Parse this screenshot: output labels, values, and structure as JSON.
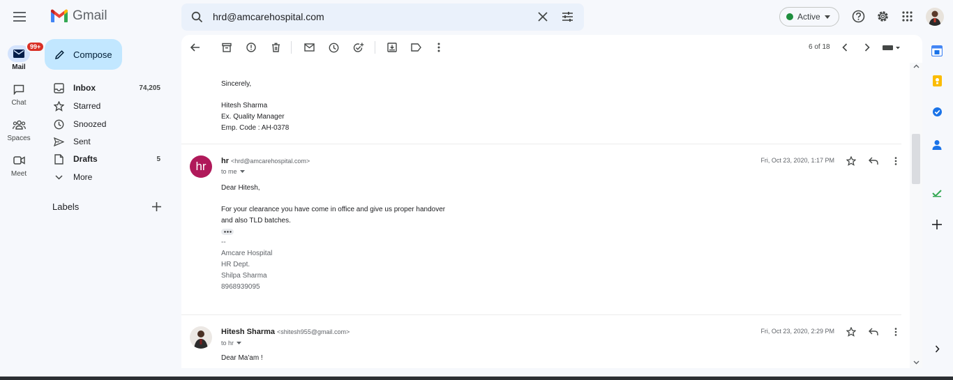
{
  "app": {
    "name": "Gmail"
  },
  "rail": {
    "mail_label": "Mail",
    "mail_badge": "99+",
    "chat_label": "Chat",
    "spaces_label": "Spaces",
    "meet_label": "Meet"
  },
  "compose_label": "Compose",
  "nav": [
    {
      "label": "Inbox",
      "count": "74,205",
      "bold": true,
      "icon": "inbox-icon"
    },
    {
      "label": "Starred",
      "count": "",
      "bold": false,
      "icon": "star-icon"
    },
    {
      "label": "Snoozed",
      "count": "",
      "bold": false,
      "icon": "clock-icon"
    },
    {
      "label": "Sent",
      "count": "",
      "bold": false,
      "icon": "send-icon"
    },
    {
      "label": "Drafts",
      "count": "5",
      "bold": true,
      "icon": "draft-icon"
    },
    {
      "label": "More",
      "count": "",
      "bold": false,
      "icon": "chevron-down-icon"
    }
  ],
  "labels_heading": "Labels",
  "search": {
    "value": "hrd@amcarehospital.com"
  },
  "status": {
    "label": "Active",
    "color": "#1e8e3e"
  },
  "toolbar": {
    "pagination": "6 of 18"
  },
  "thread": {
    "prev_signature": [
      "Sincerely,",
      "Hitesh Sharma",
      "Ex. Quality Manager",
      "Emp. Code : AH-0378"
    ],
    "message1": {
      "avatar_text": "hr",
      "avatar_color": "#b0195a",
      "sender_name": "hr",
      "sender_email": "<hrd@amcarehospital.com>",
      "recipient": "to me",
      "date": "Fri, Oct 23, 2020, 1:17 PM",
      "greeting": "Dear Hitesh,",
      "body_line1": "For your clearance you have come in office and give us proper handover",
      "body_line2": "and also TLD batches.",
      "sig_dash": "--",
      "sig": [
        "Amcare Hospital",
        "HR Dept.",
        "Shilpa Sharma",
        "8968939095"
      ]
    },
    "message2": {
      "sender_name": "Hitesh Sharma",
      "sender_email": "<shitesh955@gmail.com>",
      "recipient": "to hr",
      "date": "Fri, Oct 23, 2020, 2:29 PM",
      "greeting": "Dear Ma'am !"
    }
  },
  "colors": {
    "accent": "#0b57d0",
    "compose_bg": "#c2e7ff",
    "app_bg": "#f6f8fc"
  }
}
